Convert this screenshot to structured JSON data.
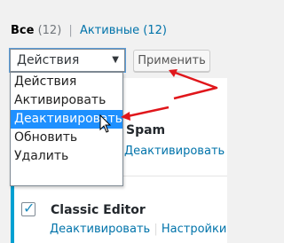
{
  "filters": {
    "all_label": "Все",
    "all_count": "(12)",
    "separator": "|",
    "active_label": "Активные",
    "active_count": "(12)"
  },
  "bulk": {
    "select_value": "Действия",
    "arrow": "▼",
    "apply_label": "Применить",
    "options": [
      "Действия",
      "Активировать",
      "Деактивировать",
      "Обновить",
      "Удалить"
    ],
    "highlighted_option": "Деактивировать"
  },
  "plugins": [
    {
      "name": "Spam",
      "actions": [
        "Деактивировать"
      ]
    },
    {
      "name": "Classic Editor",
      "actions": [
        "Деактивировать",
        "Настройки"
      ],
      "action_separator": "|",
      "checked": true
    }
  ],
  "colors": {
    "link": "#0073aa",
    "accent_strip": "#00a0d2",
    "highlight": "#1e90ff",
    "annotation_arrow": "#e0161b"
  },
  "icons": {
    "cursor": "mouse-pointer-icon",
    "check": "checkmark-icon"
  }
}
